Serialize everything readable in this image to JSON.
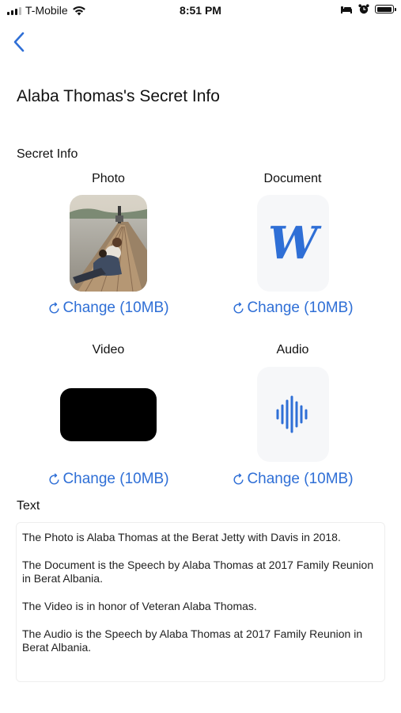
{
  "status_bar": {
    "carrier": "T-Mobile",
    "time": "8:51 PM"
  },
  "header": {
    "title": "Alaba Thomas's Secret Info"
  },
  "section_label": "Secret Info",
  "items": [
    {
      "caption": "Photo",
      "change_label": "Change (10MB)",
      "icon": "photo-thumbnail"
    },
    {
      "caption": "Document",
      "change_label": "Change (10MB)",
      "icon": "word-document-icon"
    },
    {
      "caption": "Video",
      "change_label": "Change (10MB)",
      "icon": "video-thumbnail"
    },
    {
      "caption": "Audio",
      "change_label": "Change (10MB)",
      "icon": "audio-waveform-icon"
    }
  ],
  "document_glyph": "W",
  "text_section": {
    "label": "Text",
    "paragraphs": [
      "The Photo is Alaba Thomas at the Berat Jetty with Davis in 2018.",
      "The Document is the Speech by Alaba Thomas at 2017 Family Reunion in Berat Albania.",
      "The Video is in honor of Veteran Alaba Thomas.",
      "The Audio is the Speech by Alaba Thomas at 2017 Family Reunion in Berat Albania."
    ]
  },
  "colors": {
    "accent": "#2f6fd6",
    "tile_background": "#f6f7f9"
  }
}
